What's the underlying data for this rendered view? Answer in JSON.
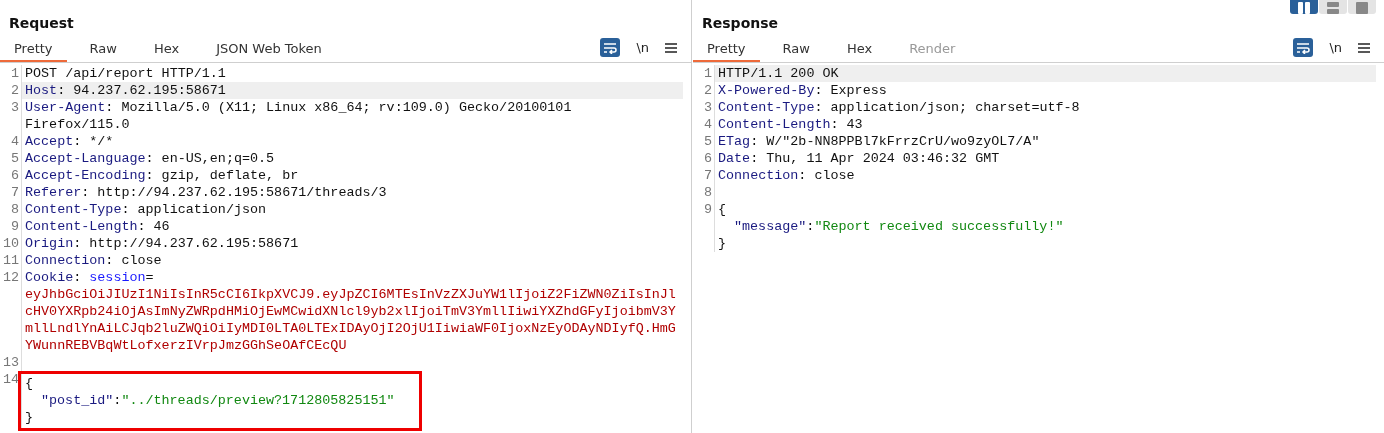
{
  "layout_toggle": [
    {
      "selected": true
    },
    {
      "selected": false
    },
    {
      "selected": false
    }
  ],
  "request": {
    "title": "Request",
    "tabs": [
      {
        "label": "Pretty",
        "selected": true,
        "disabled": false
      },
      {
        "label": "Raw",
        "selected": false,
        "disabled": false
      },
      {
        "label": "Hex",
        "selected": false,
        "disabled": false
      },
      {
        "label": "JSON Web Token",
        "selected": false,
        "disabled": false
      }
    ],
    "tools": {
      "wrap_selected": true,
      "newline_label": "\\n"
    },
    "lines": [
      {
        "number": "1",
        "highlighted": false,
        "parts": [
          {
            "kind": "plain",
            "text": "POST /api/report HTTP/1.1"
          }
        ]
      },
      {
        "number": "2",
        "highlighted": true,
        "parts": [
          {
            "kind": "name",
            "text": "Host"
          },
          {
            "kind": "plain",
            "text": ": 94.237.62.195:58671"
          }
        ]
      },
      {
        "number": "3",
        "highlighted": false,
        "parts": [
          {
            "kind": "name",
            "text": "User-Agent"
          },
          {
            "kind": "plain",
            "text": ": Mozilla/5.0 (X11; Linux x86_64; rv:109.0) Gecko/20100101 Firefox/115.0"
          }
        ]
      },
      {
        "number": "4",
        "highlighted": false,
        "parts": [
          {
            "kind": "name",
            "text": "Accept"
          },
          {
            "kind": "plain",
            "text": ": */*"
          }
        ]
      },
      {
        "number": "5",
        "highlighted": false,
        "parts": [
          {
            "kind": "name",
            "text": "Accept-Language"
          },
          {
            "kind": "plain",
            "text": ": en-US,en;q=0.5"
          }
        ]
      },
      {
        "number": "6",
        "highlighted": false,
        "parts": [
          {
            "kind": "name",
            "text": "Accept-Encoding"
          },
          {
            "kind": "plain",
            "text": ": gzip, deflate, br"
          }
        ]
      },
      {
        "number": "7",
        "highlighted": false,
        "parts": [
          {
            "kind": "name",
            "text": "Referer"
          },
          {
            "kind": "plain",
            "text": ": http://94.237.62.195:58671/threads/3"
          }
        ]
      },
      {
        "number": "8",
        "highlighted": false,
        "parts": [
          {
            "kind": "name",
            "text": "Content-Type"
          },
          {
            "kind": "plain",
            "text": ": application/json"
          }
        ]
      },
      {
        "number": "9",
        "highlighted": false,
        "parts": [
          {
            "kind": "name",
            "text": "Content-Length"
          },
          {
            "kind": "plain",
            "text": ": 46"
          }
        ]
      },
      {
        "number": "10",
        "highlighted": false,
        "parts": [
          {
            "kind": "name",
            "text": "Origin"
          },
          {
            "kind": "plain",
            "text": ": http://94.237.62.195:58671"
          }
        ]
      },
      {
        "number": "11",
        "highlighted": false,
        "parts": [
          {
            "kind": "name",
            "text": "Connection"
          },
          {
            "kind": "plain",
            "text": ": close"
          }
        ]
      },
      {
        "number": "12",
        "highlighted": false,
        "parts": [
          {
            "kind": "name",
            "text": "Cookie"
          },
          {
            "kind": "plain",
            "text": ": "
          },
          {
            "kind": "param",
            "text": "session"
          },
          {
            "kind": "plain",
            "text": "="
          },
          {
            "kind": "cookie",
            "text": "eyJhbGciOiJIUzI1NiIsInR5cCI6IkpXVCJ9.eyJpZCI6MTEsInVzZXJuYW1lIjoiZ2FiZWN0ZiIsInJlcHV0YXRpb24iOjAsImNyZWRpdHMiOjEwMCwidXNlcl9yb2xlIjoiTmV3YmllIiwiYXZhdGFyIjoibmV3YmllLndlYnAiLCJqb2luZWQiOiIyMDI0LTA0LTExIDAyOjI2OjU1IiwiaWF0IjoxNzEyODAyNDIyfQ.HmGYWunnREBVBqWtLofxerzIVrpJmzGGhSeOAfCEcQU"
          }
        ]
      },
      {
        "number": "13",
        "highlighted": false
      }
    ],
    "body": {
      "number": "14",
      "boxed": true,
      "lines": [
        {
          "parts": [
            {
              "kind": "plain",
              "text": "{"
            }
          ]
        },
        {
          "kind": "member",
          "parts": [
            {
              "kind": "key",
              "text": "\"post_id\""
            },
            {
              "kind": "plain",
              "text": ":"
            },
            {
              "kind": "string",
              "text": "\"../threads/preview?1712805825151\""
            }
          ]
        },
        {
          "parts": [
            {
              "kind": "plain",
              "text": "}"
            }
          ]
        }
      ]
    }
  },
  "response": {
    "title": "Response",
    "tabs": [
      {
        "label": "Pretty",
        "selected": true,
        "disabled": false
      },
      {
        "label": "Raw",
        "selected": false,
        "disabled": false
      },
      {
        "label": "Hex",
        "selected": false,
        "disabled": false
      },
      {
        "label": "Render",
        "selected": false,
        "disabled": true
      }
    ],
    "tools": {
      "wrap_selected": true,
      "newline_label": "\\n"
    },
    "lines": [
      {
        "number": "1",
        "highlighted": true,
        "parts": [
          {
            "kind": "plain",
            "text": "HTTP/1.1 200 OK"
          }
        ]
      },
      {
        "number": "2",
        "highlighted": false,
        "parts": [
          {
            "kind": "name",
            "text": "X-Powered-By"
          },
          {
            "kind": "plain",
            "text": ": Express"
          }
        ]
      },
      {
        "number": "3",
        "highlighted": false,
        "parts": [
          {
            "kind": "name",
            "text": "Content-Type"
          },
          {
            "kind": "plain",
            "text": ": application/json; charset=utf-8"
          }
        ]
      },
      {
        "number": "4",
        "highlighted": false,
        "parts": [
          {
            "kind": "name",
            "text": "Content-Length"
          },
          {
            "kind": "plain",
            "text": ": 43"
          }
        ]
      },
      {
        "number": "5",
        "highlighted": false,
        "parts": [
          {
            "kind": "name",
            "text": "ETag"
          },
          {
            "kind": "plain",
            "text": ": W/\"2b-NN8PPBl7kFrrzCrU/wo9zyOL7/A\""
          }
        ]
      },
      {
        "number": "6",
        "highlighted": false,
        "parts": [
          {
            "kind": "name",
            "text": "Date"
          },
          {
            "kind": "plain",
            "text": ": Thu, 11 Apr 2024 03:46:32 GMT"
          }
        ]
      },
      {
        "number": "7",
        "highlighted": false,
        "parts": [
          {
            "kind": "name",
            "text": "Connection"
          },
          {
            "kind": "plain",
            "text": ": close"
          }
        ]
      },
      {
        "number": "8",
        "highlighted": false
      }
    ],
    "body": {
      "number": "9",
      "boxed": false,
      "lines": [
        {
          "parts": [
            {
              "kind": "plain",
              "text": "{"
            }
          ]
        },
        {
          "kind": "member",
          "parts": [
            {
              "kind": "key",
              "text": "\"message\""
            },
            {
              "kind": "plain",
              "text": ":"
            },
            {
              "kind": "string",
              "text": "\"Report received successfully!\""
            }
          ]
        },
        {
          "parts": [
            {
              "kind": "plain",
              "text": "}"
            }
          ]
        }
      ]
    }
  }
}
